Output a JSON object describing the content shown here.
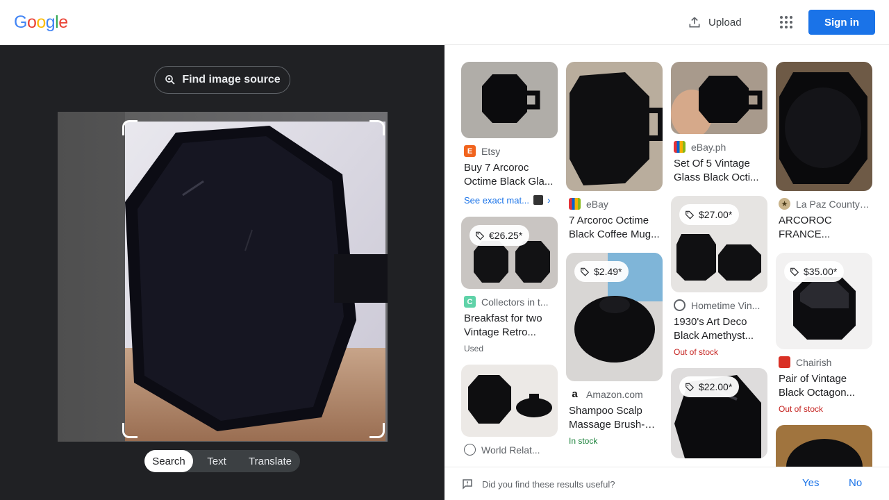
{
  "header": {
    "logo": "Google",
    "upload_label": "Upload",
    "signin_label": "Sign in"
  },
  "left": {
    "find_source_label": "Find image source",
    "modes": [
      {
        "label": "Search",
        "active": true
      },
      {
        "label": "Text",
        "active": false
      },
      {
        "label": "Translate",
        "active": false
      }
    ]
  },
  "results": {
    "col1": [
      {
        "source": "Etsy",
        "title": "Buy 7 Arcoroc Octime Black Gla...",
        "exact": "See exact mat..."
      },
      {
        "price": "€26.25*",
        "source": "Collectors in t...",
        "title": "Breakfast for two Vintage Retro...",
        "status": "Used"
      },
      {
        "source": "World Relat..."
      }
    ],
    "col2": [
      {
        "source": "eBay",
        "title": "7 Arcoroc Octime Black Coffee Mug..."
      },
      {
        "price": "$2.49*",
        "source": "Amazon.com",
        "title": "Shampoo Scalp Massage Brush- 1...",
        "status": "In stock"
      }
    ],
    "col3": [
      {
        "source": "eBay.ph",
        "title": "Set Of 5 Vintage Glass Black Octi..."
      },
      {
        "price": "$27.00*",
        "source": "Hometime Vin...",
        "title": "1930's Art Deco Black Amethyst...",
        "status": "Out of stock"
      },
      {
        "price": "$22.00*"
      }
    ],
    "col4": [
      {
        "source": "La Paz County ...",
        "title": "ARCOROC FRANCE..."
      },
      {
        "price": "$35.00*",
        "source": "Chairish",
        "title": "Pair of Vintage Black Octagon...",
        "status": "Out of stock"
      }
    ]
  },
  "feedback": {
    "question": "Did you find these results useful?",
    "yes": "Yes",
    "no": "No"
  },
  "colors": {
    "accent": "#1a73e8",
    "dark_panel": "#202124",
    "out_of_stock": "#c5221f",
    "in_stock": "#188038"
  }
}
